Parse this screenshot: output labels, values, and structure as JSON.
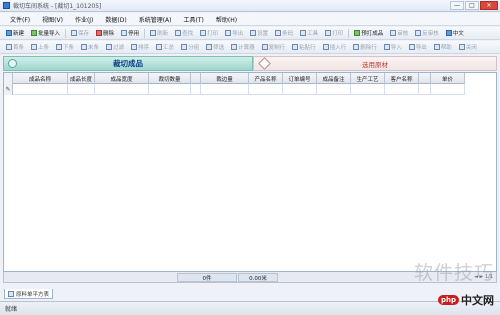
{
  "window": {
    "title": "裁切车间系统 - [裁切1_101205]",
    "min": "—",
    "max": "□",
    "close": "✕"
  },
  "menu": [
    "文件(F)",
    "视图(V)",
    "作业(J)",
    "数据(D)",
    "系统管理(A)",
    "工具(T)",
    "帮助(H)"
  ],
  "toolbar1": [
    {
      "label": "新建",
      "icon": "new-icon",
      "gray": false
    },
    {
      "label": "批量导入",
      "icon": "import-icon",
      "gray": false
    },
    {
      "label": "保存",
      "icon": "save-icon",
      "gray": true
    },
    {
      "label": "删除",
      "icon": "delete-icon",
      "gray": false
    },
    {
      "label": "停用",
      "icon": "disable-icon",
      "gray": false
    },
    {
      "label": "刷新",
      "icon": "refresh-icon",
      "gray": true
    },
    {
      "label": "查找",
      "icon": "find-icon",
      "gray": true
    },
    {
      "label": "打印",
      "icon": "print-icon",
      "gray": true
    },
    {
      "label": "导出",
      "icon": "export-icon",
      "gray": true
    },
    {
      "label": "设置",
      "icon": "settings-icon",
      "gray": true
    },
    {
      "label": "条码",
      "icon": "barcode-icon",
      "gray": true
    },
    {
      "label": "工具",
      "icon": "tool-icon",
      "gray": true
    },
    {
      "label": "打印",
      "icon": "print2-icon",
      "gray": true
    },
    {
      "label": "预打成品",
      "icon": "preprint-icon",
      "gray": false
    },
    {
      "label": "审核",
      "icon": "audit-icon",
      "gray": true
    },
    {
      "label": "反审核",
      "icon": "unaudit-icon",
      "gray": true
    },
    {
      "label": "中文",
      "icon": "lang-icon",
      "gray": false
    }
  ],
  "toolbar2": [
    "首条",
    "上条",
    "下条",
    "末条",
    "过滤",
    "排序",
    "汇总",
    "分组",
    "筛选",
    "计算器",
    "复制行",
    "粘贴行",
    "插入行",
    "删除行",
    "导入",
    "导出",
    "帮助",
    "关闭"
  ],
  "tabs": {
    "active": "裁切成品",
    "inactive": "选用原材"
  },
  "grid": {
    "columns": [
      "成品名称",
      "成品长度",
      "成品宽度",
      "裁切数量",
      "",
      "裁边量",
      "产品名称",
      "订单编号",
      "成品备注",
      "生产工艺",
      "客户名称",
      "",
      "单价"
    ],
    "row_marker": "✎"
  },
  "footer": {
    "count": "0件",
    "length": "0.00米",
    "pager": "◄ ► 1/1"
  },
  "bottom_tab": "原料单平方表",
  "status": "就绪",
  "watermark": {
    "text": "软件技巧",
    "php": "php",
    "cn": "中文网"
  }
}
